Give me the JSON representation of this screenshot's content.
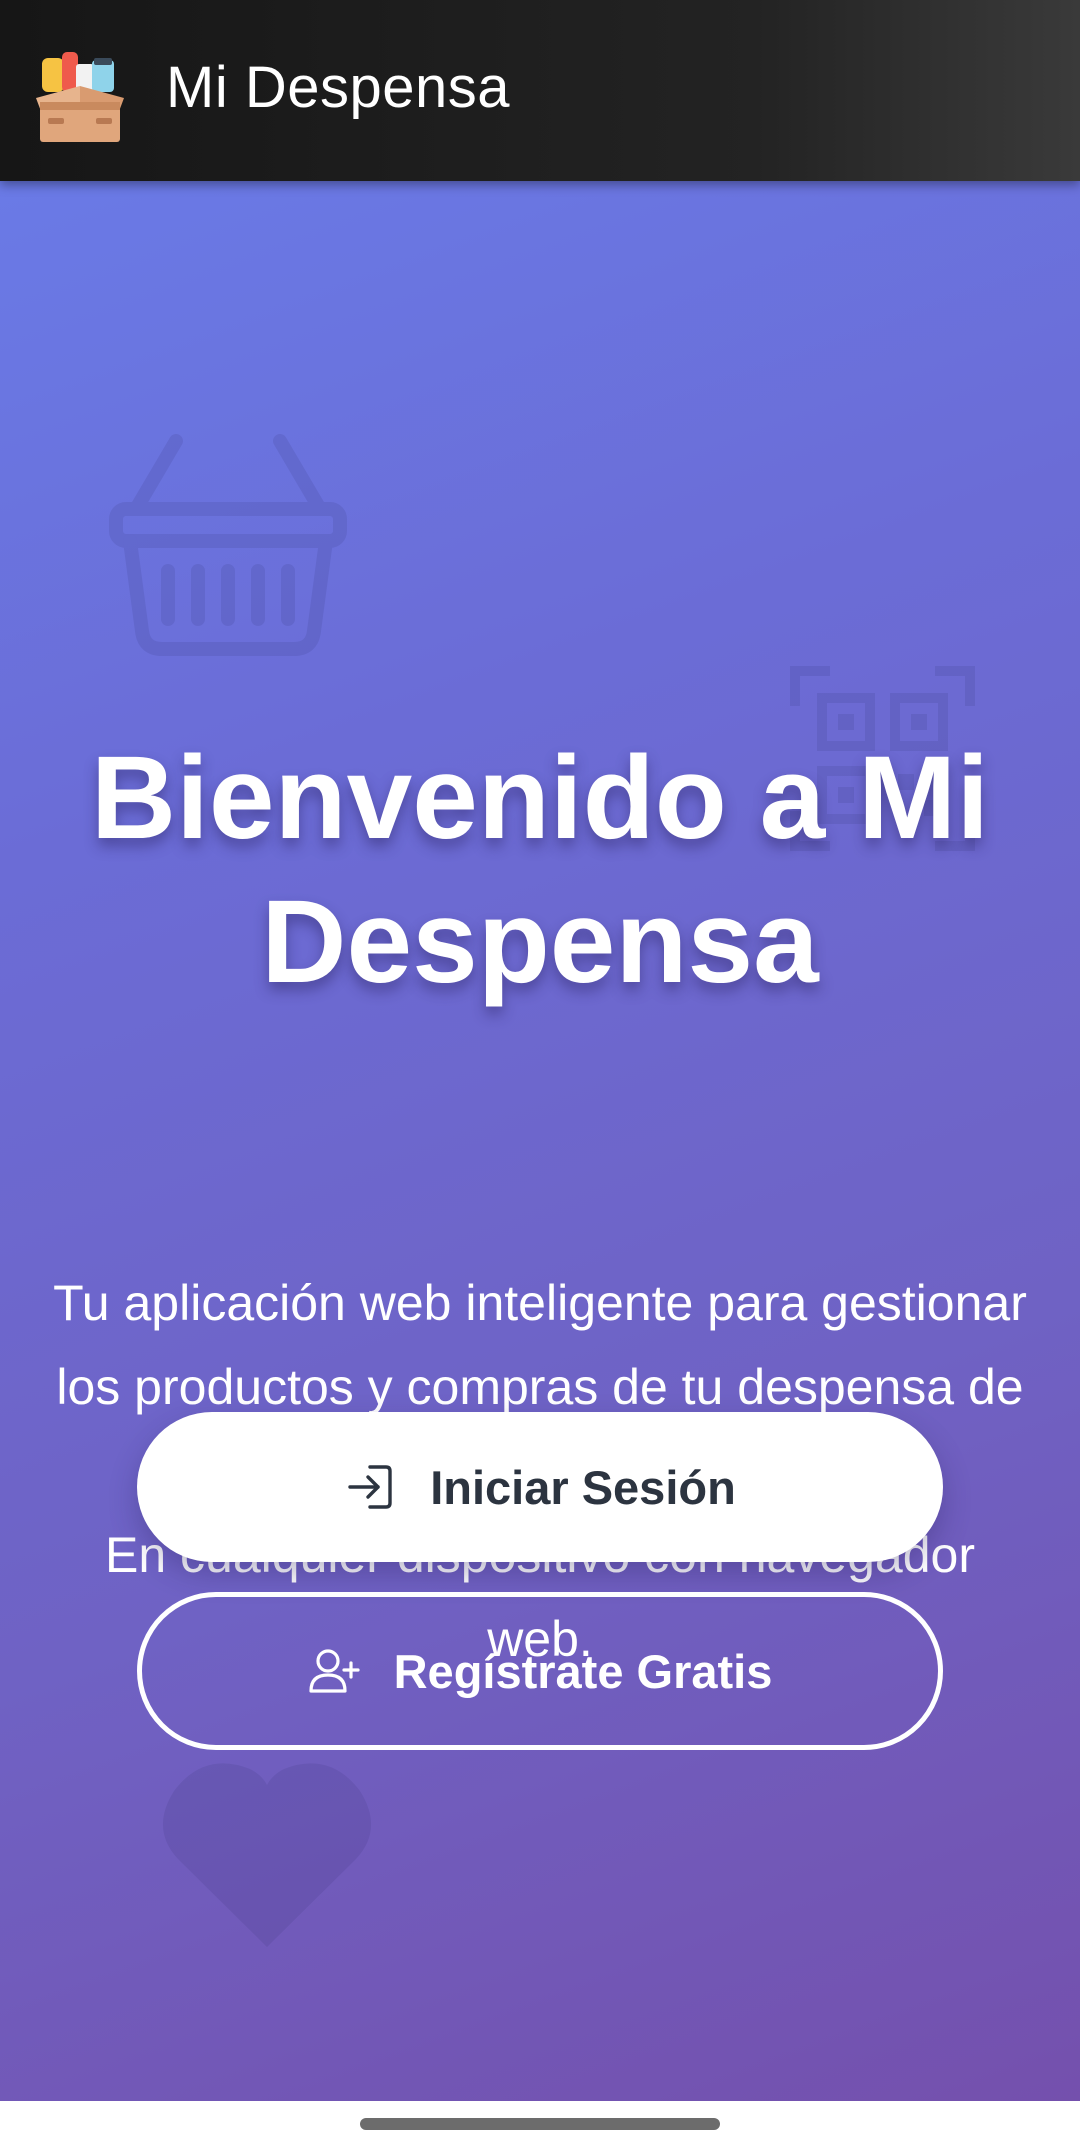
{
  "app_bar": {
    "title": "Mi Despensa",
    "logo_icon": "pantry-box-icon",
    "background": "#1c1c1c"
  },
  "hero": {
    "title": "Bienvenido a Mi Despensa",
    "description_line1": "Tu aplicación web inteligente para gestionar los productos y compras de tu despensa de manera eficiente.",
    "description_line2": "En cualquier dispositivo con navegador web.",
    "background_colors": [
      "#6a7ae6",
      "#7450ad"
    ],
    "decorative_icons": [
      "shopping-basket-icon",
      "qr-code-icon",
      "heart-icon"
    ]
  },
  "actions": {
    "login_label": "Iniciar Sesión",
    "login_icon": "login-icon",
    "register_label": "Regístrate Gratis",
    "register_icon": "user-plus-icon"
  }
}
